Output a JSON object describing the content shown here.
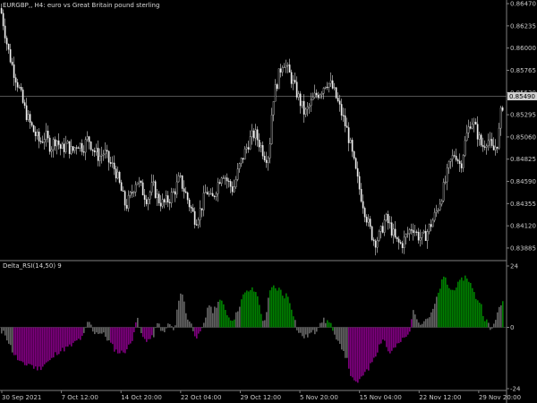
{
  "chart_data": [
    {
      "type": "candlestick",
      "title": "EURGBP,, H4: euro vs Great Britain pound sterling",
      "current_price_label": "0.85490",
      "ylim": [
        0.83875,
        0.8648
      ],
      "y_ticks": [
        "0.86470",
        "0.86235",
        "0.86000",
        "0.85765",
        "0.85530",
        "0.85295",
        "0.85060",
        "0.84825",
        "0.84590",
        "0.84355",
        "0.84120",
        "0.83885"
      ],
      "current_price": 0.8549,
      "close_path": [
        [
          0,
          0.8642
        ],
        [
          4,
          0.8622
        ],
        [
          8,
          0.86
        ],
        [
          14,
          0.8578
        ],
        [
          20,
          0.856
        ],
        [
          26,
          0.8538
        ],
        [
          32,
          0.8522
        ],
        [
          38,
          0.851
        ],
        [
          44,
          0.85
        ],
        [
          50,
          0.8508
        ],
        [
          56,
          0.8495
        ],
        [
          62,
          0.8505
        ],
        [
          68,
          0.8492
        ],
        [
          74,
          0.8498
        ],
        [
          80,
          0.849
        ],
        [
          86,
          0.85
        ],
        [
          92,
          0.8495
        ],
        [
          98,
          0.8505
        ],
        [
          104,
          0.8492
        ],
        [
          110,
          0.8485
        ],
        [
          116,
          0.849
        ],
        [
          122,
          0.8478
        ],
        [
          128,
          0.8472
        ],
        [
          134,
          0.8452
        ],
        [
          140,
          0.8432
        ],
        [
          146,
          0.8445
        ],
        [
          152,
          0.8462
        ],
        [
          158,
          0.845
        ],
        [
          164,
          0.844
        ],
        [
          170,
          0.8455
        ],
        [
          176,
          0.844
        ],
        [
          182,
          0.8435
        ],
        [
          188,
          0.844
        ],
        [
          194,
          0.8448
        ],
        [
          200,
          0.8462
        ],
        [
          206,
          0.8448
        ],
        [
          212,
          0.8432
        ],
        [
          218,
          0.8418
        ],
        [
          224,
          0.843
        ],
        [
          230,
          0.845
        ],
        [
          236,
          0.8438
        ],
        [
          242,
          0.8455
        ],
        [
          248,
          0.847
        ],
        [
          254,
          0.8458
        ],
        [
          260,
          0.845
        ],
        [
          266,
          0.8472
        ],
        [
          272,
          0.8488
        ],
        [
          278,
          0.8502
        ],
        [
          284,
          0.851
        ],
        [
          290,
          0.8498
        ],
        [
          296,
          0.8485
        ],
        [
          300,
          0.8488
        ],
        [
          304,
          0.8545
        ],
        [
          308,
          0.856
        ],
        [
          312,
          0.8575
        ],
        [
          316,
          0.8588
        ],
        [
          320,
          0.8578
        ],
        [
          324,
          0.857
        ],
        [
          328,
          0.856
        ],
        [
          334,
          0.8545
        ],
        [
          340,
          0.853
        ],
        [
          346,
          0.854
        ],
        [
          352,
          0.855
        ],
        [
          358,
          0.8555
        ],
        [
          364,
          0.8565
        ],
        [
          370,
          0.856
        ],
        [
          376,
          0.8545
        ],
        [
          382,
          0.8528
        ],
        [
          388,
          0.851
        ],
        [
          394,
          0.8482
        ],
        [
          400,
          0.8455
        ],
        [
          406,
          0.8432
        ],
        [
          412,
          0.841
        ],
        [
          418,
          0.8395
        ],
        [
          424,
          0.8402
        ],
        [
          430,
          0.842
        ],
        [
          436,
          0.841
        ],
        [
          442,
          0.8395
        ],
        [
          448,
          0.8392
        ],
        [
          454,
          0.8402
        ],
        [
          460,
          0.8412
        ],
        [
          466,
          0.8402
        ],
        [
          472,
          0.8398
        ],
        [
          478,
          0.8408
        ],
        [
          484,
          0.842
        ],
        [
          490,
          0.8435
        ],
        [
          496,
          0.8455
        ],
        [
          502,
          0.8478
        ],
        [
          508,
          0.849
        ],
        [
          514,
          0.8475
        ],
        [
          520,
          0.8505
        ],
        [
          526,
          0.8525
        ],
        [
          532,
          0.8512
        ],
        [
          538,
          0.8495
        ],
        [
          544,
          0.8505
        ],
        [
          550,
          0.849
        ],
        [
          556,
          0.8502
        ],
        [
          560,
          0.854
        ]
      ]
    },
    {
      "type": "bar",
      "title": "Delta_RSI(14,50) 9",
      "ylim": [
        -24,
        24
      ],
      "y_ticks": [
        "24",
        "0",
        "-24"
      ],
      "colors": {
        "up_strong": "#008000",
        "down_strong": "#800080",
        "neutral": "#646464"
      },
      "bars": [
        [
          0,
          -3,
          "neutral"
        ],
        [
          4,
          -2,
          "neutral"
        ],
        [
          8,
          -5,
          "neutral"
        ],
        [
          14,
          -10,
          "down_strong"
        ],
        [
          20,
          -13,
          "down_strong"
        ],
        [
          26,
          -15,
          "down_strong"
        ],
        [
          32,
          -14,
          "down_strong"
        ],
        [
          38,
          -16,
          "down_strong"
        ],
        [
          44,
          -16,
          "down_strong"
        ],
        [
          50,
          -14,
          "down_strong"
        ],
        [
          56,
          -13,
          "down_strong"
        ],
        [
          62,
          -10,
          "down_strong"
        ],
        [
          68,
          -9,
          "down_strong"
        ],
        [
          74,
          -8,
          "down_strong"
        ],
        [
          80,
          -7,
          "down_strong"
        ],
        [
          86,
          -5,
          "down_strong"
        ],
        [
          92,
          -4,
          "neutral"
        ],
        [
          98,
          3,
          "neutral"
        ],
        [
          104,
          -2,
          "neutral"
        ],
        [
          110,
          -2,
          "neutral"
        ],
        [
          116,
          -3,
          "neutral"
        ],
        [
          122,
          -6,
          "down_strong"
        ],
        [
          128,
          -9,
          "down_strong"
        ],
        [
          134,
          -10,
          "down_strong"
        ],
        [
          140,
          -9,
          "down_strong"
        ],
        [
          146,
          -6,
          "down_strong"
        ],
        [
          152,
          4,
          "neutral"
        ],
        [
          158,
          -4,
          "down_strong"
        ],
        [
          164,
          -5,
          "down_strong"
        ],
        [
          170,
          -4,
          "neutral"
        ],
        [
          176,
          2,
          "neutral"
        ],
        [
          182,
          -3,
          "neutral"
        ],
        [
          188,
          2,
          "neutral"
        ],
        [
          194,
          -2,
          "neutral"
        ],
        [
          200,
          14,
          "neutral"
        ],
        [
          204,
          12,
          "neutral"
        ],
        [
          208,
          4,
          "neutral"
        ],
        [
          212,
          2,
          "neutral"
        ],
        [
          216,
          -2,
          "down_strong"
        ],
        [
          220,
          -4,
          "down_strong"
        ],
        [
          224,
          -2,
          "neutral"
        ],
        [
          228,
          2,
          "neutral"
        ],
        [
          232,
          10,
          "neutral"
        ],
        [
          236,
          6,
          "neutral"
        ],
        [
          240,
          8,
          "neutral"
        ],
        [
          244,
          11,
          "up_strong"
        ],
        [
          250,
          8,
          "up_strong"
        ],
        [
          256,
          3,
          "up_strong"
        ],
        [
          262,
          4,
          "neutral"
        ],
        [
          268,
          10,
          "up_strong"
        ],
        [
          272,
          13,
          "up_strong"
        ],
        [
          276,
          14,
          "up_strong"
        ],
        [
          280,
          15,
          "up_strong"
        ],
        [
          284,
          14,
          "up_strong"
        ],
        [
          288,
          12,
          "up_strong"
        ],
        [
          292,
          2,
          "neutral"
        ],
        [
          296,
          4,
          "neutral"
        ],
        [
          300,
          13,
          "up_strong"
        ],
        [
          304,
          16,
          "up_strong"
        ],
        [
          308,
          15,
          "up_strong"
        ],
        [
          312,
          15,
          "up_strong"
        ],
        [
          316,
          12,
          "up_strong"
        ],
        [
          320,
          13,
          "up_strong"
        ],
        [
          324,
          9,
          "up_strong"
        ],
        [
          328,
          4,
          "neutral"
        ],
        [
          332,
          -2,
          "neutral"
        ],
        [
          336,
          -3,
          "neutral"
        ],
        [
          340,
          -4,
          "neutral"
        ],
        [
          344,
          -3,
          "neutral"
        ],
        [
          348,
          -2,
          "neutral"
        ],
        [
          352,
          -2,
          "neutral"
        ],
        [
          356,
          2,
          "neutral"
        ],
        [
          360,
          3,
          "neutral"
        ],
        [
          364,
          2,
          "up_strong"
        ],
        [
          368,
          3,
          "up_strong"
        ],
        [
          372,
          -3,
          "neutral"
        ],
        [
          376,
          -6,
          "neutral"
        ],
        [
          382,
          -8,
          "neutral"
        ],
        [
          388,
          -14,
          "down_strong"
        ],
        [
          392,
          -20,
          "down_strong"
        ],
        [
          396,
          -22,
          "down_strong"
        ],
        [
          400,
          -21,
          "down_strong"
        ],
        [
          404,
          -20,
          "down_strong"
        ],
        [
          408,
          -16,
          "down_strong"
        ],
        [
          412,
          -16,
          "down_strong"
        ],
        [
          416,
          -12,
          "down_strong"
        ],
        [
          420,
          -10,
          "down_strong"
        ],
        [
          424,
          -6,
          "down_strong"
        ],
        [
          428,
          -4,
          "down_strong"
        ],
        [
          432,
          -9,
          "down_strong"
        ],
        [
          436,
          -10,
          "down_strong"
        ],
        [
          440,
          -8,
          "down_strong"
        ],
        [
          444,
          -7,
          "down_strong"
        ],
        [
          448,
          -5,
          "down_strong"
        ],
        [
          452,
          -4,
          "down_strong"
        ],
        [
          456,
          -3,
          "down_strong"
        ],
        [
          460,
          6,
          "neutral"
        ],
        [
          464,
          5,
          "neutral"
        ],
        [
          468,
          2,
          "neutral"
        ],
        [
          472,
          2,
          "neutral"
        ],
        [
          476,
          4,
          "neutral"
        ],
        [
          480,
          4,
          "neutral"
        ],
        [
          484,
          8,
          "neutral"
        ],
        [
          488,
          12,
          "up_strong"
        ],
        [
          492,
          17,
          "up_strong"
        ],
        [
          496,
          20,
          "up_strong"
        ],
        [
          500,
          16,
          "up_strong"
        ],
        [
          504,
          14,
          "up_strong"
        ],
        [
          508,
          16,
          "up_strong"
        ],
        [
          512,
          17,
          "up_strong"
        ],
        [
          516,
          19,
          "up_strong"
        ],
        [
          520,
          20,
          "up_strong"
        ],
        [
          524,
          18,
          "up_strong"
        ],
        [
          528,
          14,
          "up_strong"
        ],
        [
          532,
          11,
          "up_strong"
        ],
        [
          536,
          10,
          "up_strong"
        ],
        [
          540,
          4,
          "up_strong"
        ],
        [
          544,
          2,
          "neutral"
        ],
        [
          548,
          -2,
          "neutral"
        ],
        [
          552,
          3,
          "neutral"
        ],
        [
          556,
          6,
          "neutral"
        ],
        [
          560,
          10,
          "up_strong"
        ]
      ]
    }
  ],
  "x_axis_labels": [
    "30 Sep 2021",
    "7 Oct 12:00",
    "14 Oct 20:00",
    "22 Oct 04:00",
    "29 Oct 12:00",
    "5 Nov 20:00",
    "15 Nov 04:00",
    "22 Nov 12:00",
    "29 Nov 20:00"
  ]
}
